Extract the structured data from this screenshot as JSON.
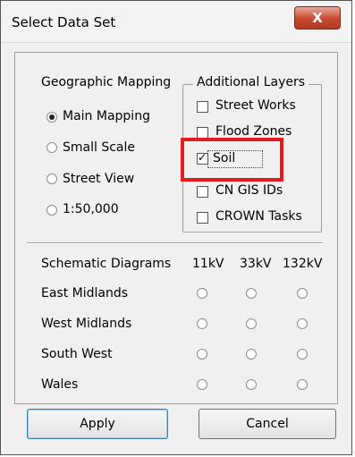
{
  "window": {
    "title": "Select Data Set",
    "close_symbol": "X"
  },
  "geo": {
    "title": "Geographic Mapping",
    "options": [
      {
        "label": "Main Mapping",
        "checked": true
      },
      {
        "label": "Small Scale",
        "checked": false
      },
      {
        "label": "Street View",
        "checked": false
      },
      {
        "label": "1:50,000",
        "checked": false
      }
    ]
  },
  "layers": {
    "title": "Additional Layers",
    "items": [
      {
        "label": "Street Works",
        "checked": false
      },
      {
        "label": "Flood Zones",
        "checked": false
      },
      {
        "label": "Soil",
        "checked": true
      },
      {
        "label": "CN GIS IDs",
        "checked": false
      },
      {
        "label": "CROWN Tasks",
        "checked": false
      }
    ]
  },
  "schematic": {
    "title": "Schematic Diagrams",
    "columns": [
      "11kV",
      "33kV",
      "132kV"
    ],
    "rows": [
      "East Midlands",
      "West Midlands",
      "South West",
      "Wales"
    ]
  },
  "buttons": {
    "apply": "Apply",
    "cancel": "Cancel"
  },
  "colors": {
    "highlight": "#e31b23",
    "close_button": "#c7462e"
  }
}
